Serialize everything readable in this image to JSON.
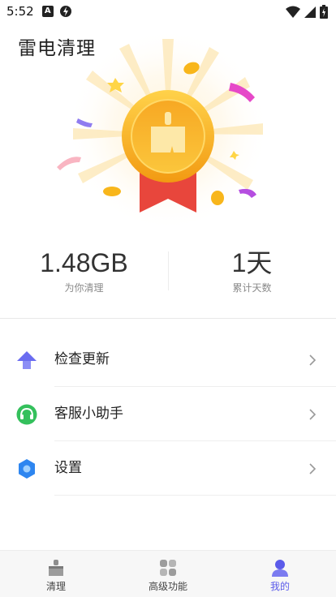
{
  "status_bar": {
    "time": "5:52"
  },
  "app": {
    "title": "雷电清理"
  },
  "stats": {
    "cleaned": {
      "value": "1.48GB",
      "label": "为你清理"
    },
    "days": {
      "value": "1天",
      "label": "累计天数"
    }
  },
  "menu": {
    "items": [
      {
        "label": "检查更新",
        "icon": "upgrade-arrow-icon"
      },
      {
        "label": "客服小助手",
        "icon": "headset-icon"
      },
      {
        "label": "设置",
        "icon": "gear-icon"
      }
    ]
  },
  "nav": {
    "tabs": [
      {
        "label": "清理",
        "icon": "broom-icon",
        "active": false
      },
      {
        "label": "高级功能",
        "icon": "grid-icon",
        "active": false
      },
      {
        "label": "我的",
        "icon": "user-icon",
        "active": true
      }
    ]
  },
  "colors": {
    "accent": "#5b5bea",
    "medal_gold": "#f6b01e",
    "ribbon": "#e8463c"
  }
}
